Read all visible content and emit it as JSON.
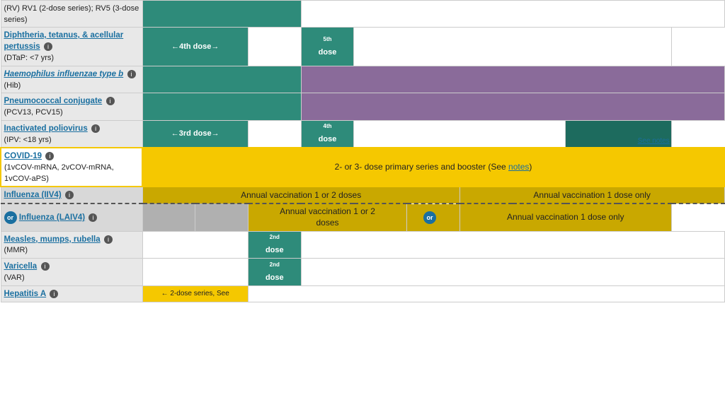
{
  "vaccines": [
    {
      "id": "rv",
      "name": "(RV) RV1 (2-dose series); RV5 (3-dose series)",
      "is_link": false,
      "sub": ""
    },
    {
      "id": "dtap",
      "name": "Diphtheria, tetanus, & acellular pertussis",
      "is_link": true,
      "sub": "(DTaP: <7 yrs)",
      "has_info": true
    },
    {
      "id": "hib",
      "name": "Haemophilus influenzae type b",
      "is_link": true,
      "sub": "(Hib)",
      "has_info": true,
      "italic": true
    },
    {
      "id": "pcv",
      "name": "Pneumococcal conjugate",
      "is_link": true,
      "sub": "(PCV13, PCV15)",
      "has_info": true
    },
    {
      "id": "ipv",
      "name": "Inactivated poliovirus",
      "is_link": true,
      "sub": "(IPV: <18 yrs)",
      "has_info": true
    },
    {
      "id": "covid",
      "name": "COVID-19",
      "is_link": true,
      "sub": "(1vCOV-mRNA, 2vCOV-mRNA, 1vCOV-aPS)",
      "has_info": true,
      "special": "covid"
    },
    {
      "id": "iiv4",
      "name": "Influenza (IIV4)",
      "is_link": true,
      "has_info": true
    },
    {
      "id": "laiv4",
      "name": "Influenza (LAIV4)",
      "is_link": true,
      "has_info": true,
      "has_or": true
    },
    {
      "id": "mmr",
      "name": "Measles, mumps, rubella",
      "is_link": true,
      "sub": "(MMR)",
      "has_info": true
    },
    {
      "id": "var",
      "name": "Varicella",
      "is_link": true,
      "sub": "(VAR)",
      "has_info": true
    },
    {
      "id": "hepa",
      "name": "Hepatitis A",
      "is_link": true,
      "has_info": true
    }
  ],
  "colors": {
    "teal": "#2e8b7a",
    "dark_teal": "#1d6b5e",
    "purple": "#8a6b9a",
    "yellow": "#f5c800",
    "dark_yellow": "#c9a800",
    "gray": "#b0b0b0",
    "light_gray": "#d8d8d8",
    "white": "#ffffff",
    "vaccine_col_bg": "#e8e8e8"
  },
  "labels": {
    "dtap_4th": "←4th dose→",
    "dtap_5th_top": "5th",
    "dtap_5th_bot": "dose",
    "ipv_3rd": "←3rd dose→",
    "ipv_4th_top": "4th",
    "ipv_4th_bot": "dose",
    "ipv_see_notes": "See notes",
    "covid_text": "2- or 3- dose primary series and booster (See notes)",
    "iiv4_annual1": "Annual vaccination 1 or 2 doses",
    "iiv4_annual2": "Annual vaccination 1 dose only",
    "laiv4_annual1": "Annual vaccination 1 or 2 doses",
    "laiv4_annual2": "Annual vaccination 1 dose only",
    "mmr_2nd_top": "2nd",
    "mmr_2nd_bot": "dose",
    "var_2nd_top": "2nd",
    "var_2nd_bot": "dose",
    "hepa_text": "← 2-dose series, See"
  }
}
